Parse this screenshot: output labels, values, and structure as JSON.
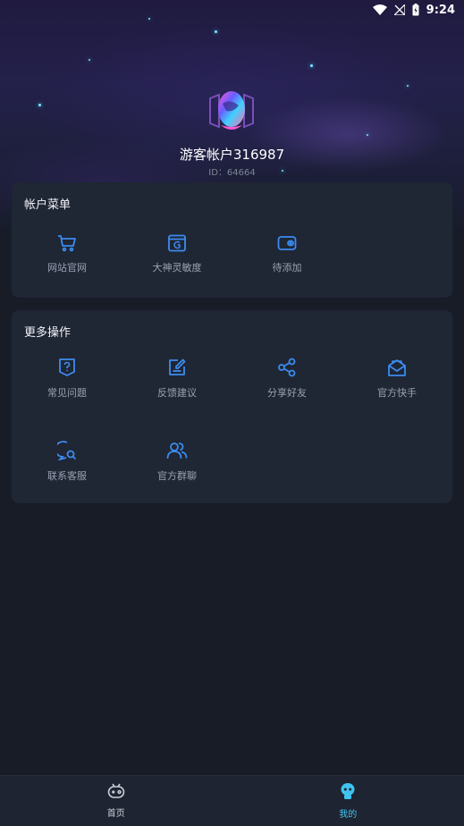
{
  "status_bar": {
    "time": "9:24"
  },
  "profile": {
    "username": "游客帐户316987",
    "user_id": "ID：64664"
  },
  "account_menu": {
    "title": "帐户菜单",
    "items": [
      {
        "label": "网站官网",
        "icon": "cart-icon"
      },
      {
        "label": "大神灵敏度",
        "icon": "g-card-icon"
      },
      {
        "label": "待添加",
        "icon": "wallet-icon"
      }
    ]
  },
  "more_actions": {
    "title": "更多操作",
    "items": [
      {
        "label": "常见问题",
        "icon": "question-shield-icon"
      },
      {
        "label": "反馈建议",
        "icon": "edit-note-icon"
      },
      {
        "label": "分享好友",
        "icon": "share-icon"
      },
      {
        "label": "官方快手",
        "icon": "mail-open-icon"
      },
      {
        "label": "联系客服",
        "icon": "chat-search-icon"
      },
      {
        "label": "官方群聊",
        "icon": "users-icon"
      }
    ]
  },
  "tab_bar": {
    "tabs": [
      {
        "label": "首页",
        "icon": "gamepad-icon",
        "active": false
      },
      {
        "label": "我的",
        "icon": "robot-icon",
        "active": true
      }
    ]
  },
  "colors": {
    "accent": "#3b8cf0",
    "active_tab": "#3fc3f0",
    "card": "#1f2634",
    "background": "#171c27"
  }
}
